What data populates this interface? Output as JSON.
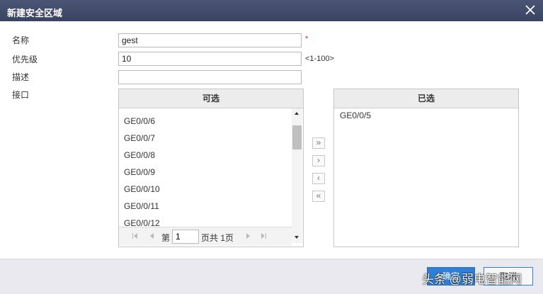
{
  "dialog": {
    "title": "新建安全区域"
  },
  "form": {
    "name_label": "名称",
    "name_value": "gest",
    "required_mark": "*",
    "priority_label": "优先级",
    "priority_value": "10",
    "priority_hint": "<1-100>",
    "desc_label": "描述",
    "desc_value": "",
    "iface_label": "接口"
  },
  "available": {
    "header": "可选",
    "items": [
      "GE0/0/6",
      "GE0/0/7",
      "GE0/0/8",
      "GE0/0/9",
      "GE0/0/10",
      "GE0/0/11",
      "GE0/0/12"
    ],
    "scroll_fraction": 0.1
  },
  "pager": {
    "prefix": "第",
    "page": "1",
    "suffix": "页共 1页"
  },
  "move_buttons": {
    "add_all": "»",
    "add": "›",
    "remove": "‹",
    "remove_all": "«"
  },
  "selected": {
    "header": "已选",
    "items": [
      "GE0/0/5"
    ]
  },
  "footer": {
    "ok_label": "确定",
    "cancel_label": "取消"
  },
  "watermark": "头条 @弱电智能网",
  "colors": {
    "titlebar": "#3f4a6b",
    "primary": "#2f7fd6",
    "required": "#e02020"
  }
}
